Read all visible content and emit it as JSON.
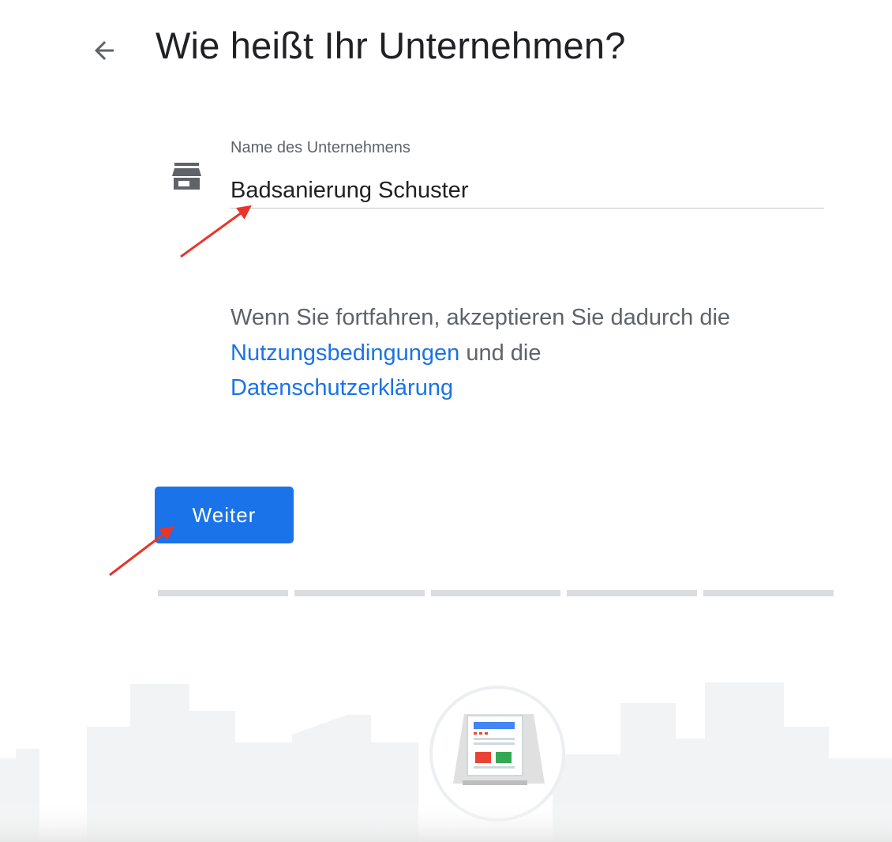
{
  "header": {
    "title": "Wie heißt Ihr Unternehmen?",
    "back_icon": "arrow-back-icon"
  },
  "form": {
    "field_icon": "storefront-icon",
    "field_label": "Name des Unternehmens",
    "field_value": "Badsanierung Schuster"
  },
  "terms": {
    "text_before": "Wenn Sie fortfahren, akzeptieren Sie dadurch die",
    "terms_link": "Nutzungsbedingungen",
    "text_middle": "und die",
    "privacy_link": "Datenschutzerklärung"
  },
  "actions": {
    "next_label": "Weiter"
  },
  "progress": {
    "total_steps": 5
  },
  "colors": {
    "accent": "#1a73e8",
    "title": "#202124",
    "secondary_text": "#5f6368",
    "annotation_arrow": "#e8352b"
  }
}
